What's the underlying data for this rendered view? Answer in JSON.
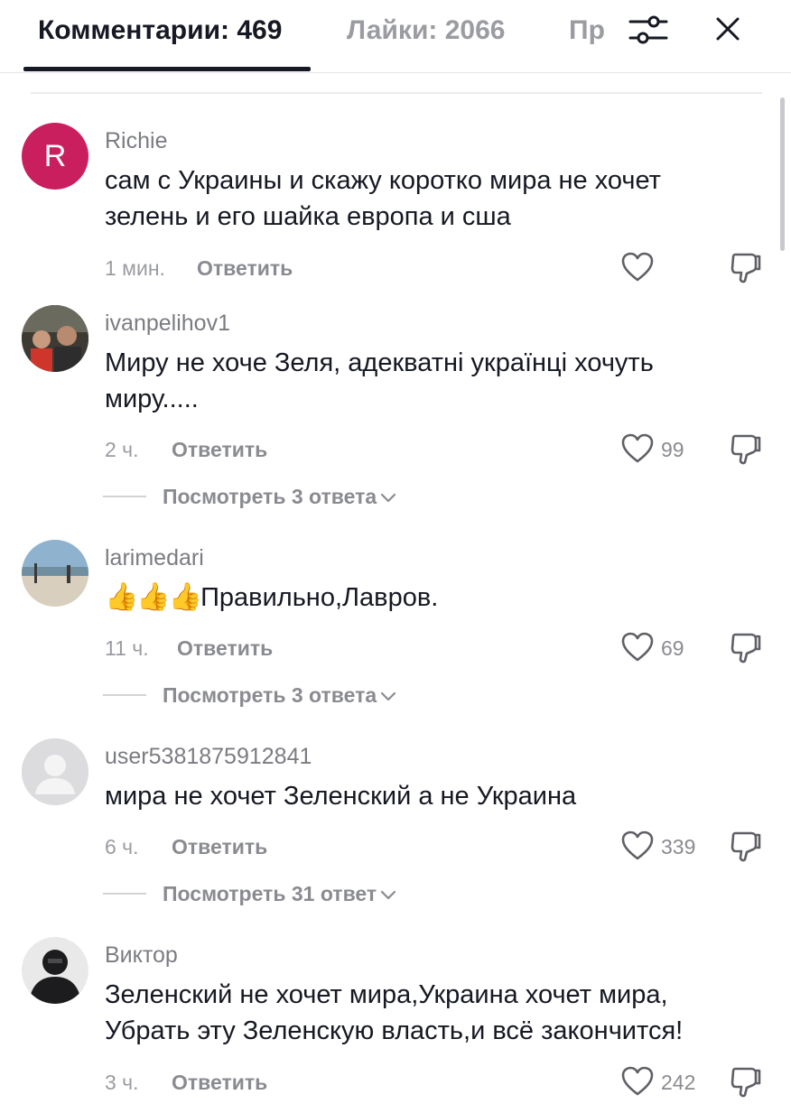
{
  "tabs": {
    "comments_label": "Комментарии: 469",
    "likes_label": "Лайки: 2066",
    "more_label": "Пр"
  },
  "actions": {
    "filter_icon": "sliders-icon",
    "close_icon": "close-icon"
  },
  "comments": [
    {
      "username": "Richie",
      "avatar_letter": "R",
      "text_lines": [
        "сам с Украины и скажу коротко мира не хочет",
        "зелень и его шайка европа и сша"
      ],
      "time": "1 мин.",
      "reply_label": "Ответить",
      "likes": "",
      "view_replies": ""
    },
    {
      "username": "ivanpelihov1",
      "text_lines": [
        "Миру не хоче Зеля, адекватні українці хочуть",
        "миру....."
      ],
      "time": "2 ч.",
      "reply_label": "Ответить",
      "likes": "99",
      "view_replies": "Посмотреть 3 ответа"
    },
    {
      "username": "larimedari",
      "emoji": "👍👍👍",
      "text": "Правильно,Лавров.",
      "time": "11 ч.",
      "reply_label": "Ответить",
      "likes": "69",
      "view_replies": "Посмотреть 3 ответа"
    },
    {
      "username": "user5381875912841",
      "text": "мира не хочет Зеленский а не Украина",
      "time": "6 ч.",
      "reply_label": "Ответить",
      "likes": "339",
      "view_replies": "Посмотреть 31 ответ"
    },
    {
      "username": "Виктор",
      "text_lines": [
        "Зеленский не хочет мира,Украина хочет мира,",
        "Убрать эту Зеленскую власть,и всё закончится!"
      ],
      "time": "3 ч.",
      "reply_label": "Ответить",
      "likes": "242"
    }
  ],
  "colors": {
    "accent_avatar": "#c91f5e",
    "text_primary": "#161823",
    "text_secondary": "#8a8b91"
  }
}
